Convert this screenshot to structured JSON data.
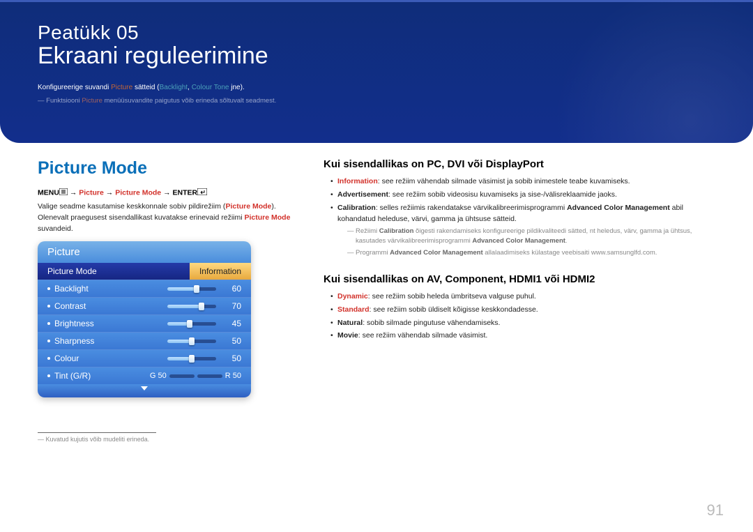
{
  "chapter": {
    "number_label": "Peatükk  05",
    "title": "Ekraani reguleerimine",
    "subtext_prefix": "Konfigureerige suvandi ",
    "subtext_picture": "Picture",
    "subtext_mid": " sätteid (",
    "subtext_backlight": "Backlight",
    "subtext_sep": ", ",
    "subtext_colourtone": "Colour Tone",
    "subtext_suffix": " jne).",
    "note_dash": "―  Funktsiooni ",
    "note_picture": "Picture",
    "note_rest": " menüüsuvandite paigutus võib erineda sõltuvalt seadmest."
  },
  "left": {
    "section_title": "Picture Mode",
    "menu_label": "MENU",
    "arrow": " → ",
    "nav_picture": "Picture",
    "nav_picturemode": "Picture Mode",
    "enter_label": "ENTER",
    "para1_a": "Valige seadme kasutamise keskkonnale sobiv pildirežiim (",
    "para1_pm": "Picture Mode",
    "para1_b": ").",
    "para2_a": "Olenevalt praegusest sisendallikast kuvatakse erinevaid režiimi ",
    "para2_pm": "Picture Mode",
    "para2_b": " suvandeid.",
    "footnote": "Kuvatud kujutis võib mudeliti erineda."
  },
  "osd": {
    "title": "Picture",
    "header_left": "Picture Mode",
    "header_right": "Information",
    "rows": [
      {
        "label": "Backlight",
        "value": "60",
        "pct": 60
      },
      {
        "label": "Contrast",
        "value": "70",
        "pct": 70
      },
      {
        "label": "Brightness",
        "value": "45",
        "pct": 45
      },
      {
        "label": "Sharpness",
        "value": "50",
        "pct": 50
      },
      {
        "label": "Colour",
        "value": "50",
        "pct": 50
      }
    ],
    "tint": {
      "label": "Tint (G/R)",
      "g_label": "G 50",
      "r_label": "R 50"
    }
  },
  "right": {
    "h1": "Kui sisendallikas on PC, DVI või DisplayPort",
    "bullets1": [
      {
        "term": "Information",
        "red": true,
        "text": ": see režiim vähendab silmade väsimist ja sobib inimestele teabe kuvamiseks."
      },
      {
        "term": "Advertisement",
        "red": false,
        "text": ": see režiim sobib videosisu kuvamiseks ja sise-/välisreklaamide jaoks."
      },
      {
        "term": "Calibration",
        "red": false,
        "text": ": selles režiimis rakendatakse värvikalibreerimisprogrammi ",
        "bold_after": "Advanced Color Management",
        "tail": " abil kohandatud heleduse, värvi, gamma ja ühtsuse sätteid.",
        "subs": [
          {
            "pre": "Režiimi ",
            "bold1": "Calibration",
            "mid": " õigesti rakendamiseks konfigureerige pildikvaliteedi sätted, nt heledus, värv, gamma ja ühtsus, kasutades värvikalibreerimisprogrammi ",
            "bold2": "Advanced Color Management",
            "suf": "."
          },
          {
            "pre": "Programmi ",
            "bold1": "Advanced Color Management",
            "mid": " allalaadimiseks külastage veebisaiti www.samsunglfd.com.",
            "bold2": "",
            "suf": ""
          }
        ]
      }
    ],
    "h2": "Kui sisendallikas on AV, Component, HDMI1 või HDMI2",
    "bullets2": [
      {
        "term": "Dynamic",
        "red": true,
        "text": ": see režiim sobib heleda ümbritseva valguse puhul."
      },
      {
        "term": "Standard",
        "red": true,
        "text": ": see režiim sobib üldiselt kõigisse keskkondadesse."
      },
      {
        "term": "Natural",
        "red": false,
        "text": ": sobib silmade pingutuse vähendamiseks."
      },
      {
        "term": "Movie",
        "red": false,
        "text": ": see režiim vähendab silmade väsimist."
      }
    ]
  },
  "page_number": "91"
}
